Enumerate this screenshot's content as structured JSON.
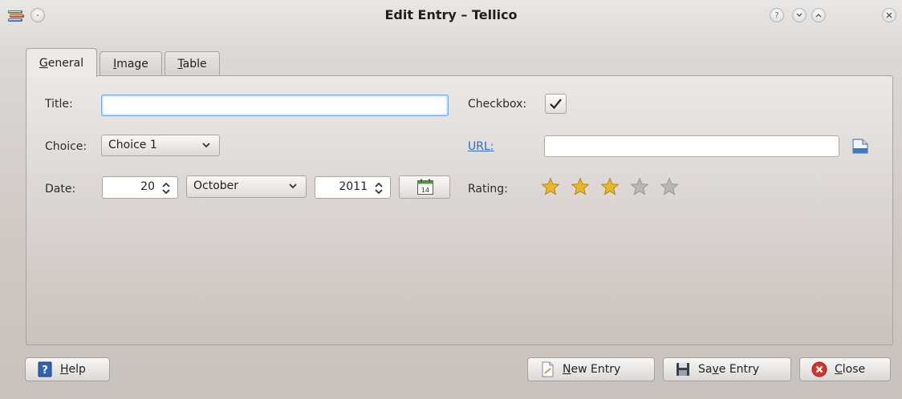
{
  "window": {
    "title": "Edit Entry – Tellico"
  },
  "tabs": [
    {
      "pre": "",
      "ul": "G",
      "post": "eneral"
    },
    {
      "pre": "",
      "ul": "I",
      "post": "mage"
    },
    {
      "pre": "",
      "ul": "T",
      "post": "able"
    }
  ],
  "fields": {
    "title_label": "Title:",
    "title_value": "",
    "choice_label": "Choice:",
    "choice_value": "Choice 1",
    "date_label": "Date:",
    "day": "20",
    "month": "October",
    "year": "2011",
    "calendar_day": "14",
    "checkbox_label": "Checkbox:",
    "checkbox_checked": true,
    "url_label": "URL:",
    "url_value": "",
    "rating_label": "Rating:",
    "rating": 3,
    "rating_max": 5
  },
  "buttons": {
    "help": {
      "pre": "",
      "ul": "H",
      "post": "elp"
    },
    "new_entry": {
      "pre": "",
      "ul": "N",
      "post": "ew Entry"
    },
    "save_entry": {
      "pre": "Sa",
      "ul": "v",
      "post": "e Entry"
    },
    "close": {
      "pre": "",
      "ul": "C",
      "post": "lose"
    }
  },
  "colors": {
    "star_filled": "#e8b923",
    "star_empty": "#b9b6b3",
    "link": "#2c6fbf",
    "focus": "#76a9d6"
  }
}
